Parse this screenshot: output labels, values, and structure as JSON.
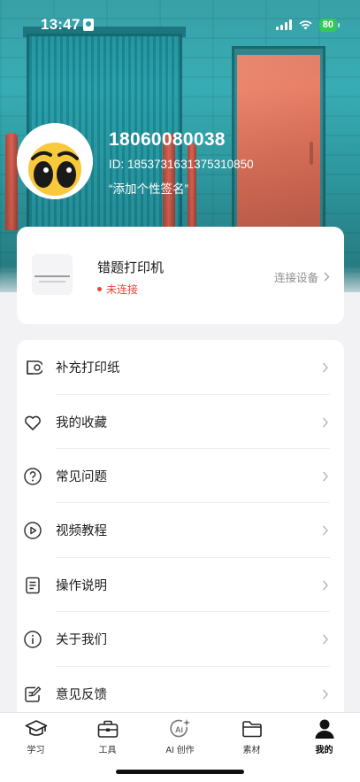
{
  "status_bar": {
    "time": "13:47",
    "battery": "80"
  },
  "profile": {
    "phone": "18060080038",
    "id_text": "ID: 1853731631375310850",
    "signature": "“添加个性签名”"
  },
  "printer": {
    "name": "错题打印机",
    "status": "未连接",
    "connect_label": "连接设备",
    "status_color": "#e5483a"
  },
  "menu": {
    "items": [
      {
        "label": "补充打印纸",
        "icon": "paper-roll-icon"
      },
      {
        "label": "我的收藏",
        "icon": "heart-icon"
      },
      {
        "label": "常见问题",
        "icon": "question-circle-icon"
      },
      {
        "label": "视频教程",
        "icon": "play-circle-icon"
      },
      {
        "label": "操作说明",
        "icon": "document-icon"
      },
      {
        "label": "关于我们",
        "icon": "info-circle-icon"
      },
      {
        "label": "意见反馈",
        "icon": "feedback-edit-icon"
      }
    ]
  },
  "tabs": [
    {
      "label": "学习",
      "icon": "graduation-cap-icon",
      "active": false
    },
    {
      "label": "工具",
      "icon": "toolbox-icon",
      "active": false
    },
    {
      "label": "AI 创作",
      "icon": "ai-sparkle-icon",
      "active": false
    },
    {
      "label": "素材",
      "icon": "folder-icon",
      "active": false
    },
    {
      "label": "我的",
      "icon": "person-icon",
      "active": true
    }
  ]
}
